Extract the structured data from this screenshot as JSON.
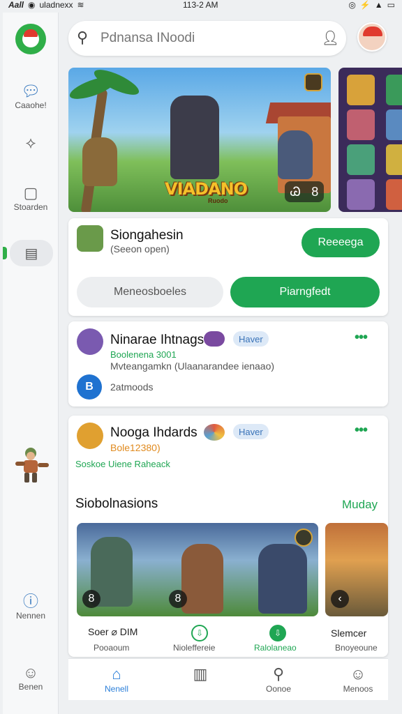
{
  "status_bar": {
    "carrier": "Aall",
    "network": "uladnexx",
    "time": "113-2 AM"
  },
  "rail": {
    "items": [
      {
        "label": "Caaohe!",
        "icon": "chat-bubble-icon"
      },
      {
        "label": "",
        "icon": "share-icon"
      },
      {
        "label": "Stoarden",
        "icon": "store-icon"
      },
      {
        "label": "",
        "icon": "calendar-icon"
      },
      {
        "label": "Nennen",
        "icon": "info-icon"
      },
      {
        "label": "Benen",
        "icon": "profile-icon"
      }
    ]
  },
  "search": {
    "placeholder": "Pdnansa INoodi"
  },
  "hero": {
    "title": "VIADANO",
    "subtitle": "Ruodo",
    "count_icon": "Ꮚ",
    "count": "8"
  },
  "featured": {
    "title": "Siongahesin",
    "subtitle": "(Seeon open)",
    "action_label": "Reeeega",
    "tab_left": "Meneosboeles",
    "tab_right": "Piarngfedt"
  },
  "post1": {
    "title": "Ninarae Ihtnags",
    "pill": "Haver",
    "green_line": "Boolenena 3001",
    "desc": "Mvteangamkn (Ulaanarandee ienaao)",
    "footer_text": "2atmoods",
    "footer_icon_letter": "B"
  },
  "post2": {
    "title": "Nooga Ihdards",
    "pill": "Haver",
    "orange_line": "Bole12380)",
    "green_line": "Soskoe Uiene  Raheack"
  },
  "section": {
    "title": "Siobolnasions",
    "action": "Muday"
  },
  "thumbs": [
    {
      "badge_left": "8",
      "badge_center": "8",
      "label": "Soer ⌀ DIM",
      "sub": "Pooaoum"
    },
    {
      "label": "",
      "sub": "Nioleffereie"
    },
    {
      "label": "",
      "sub": "Ralolaneao"
    },
    {
      "label": "Slemcer",
      "sub": "Bnoyeoune"
    }
  ],
  "bottom_nav": [
    {
      "label": "Nenell",
      "icon": "home-icon",
      "active": true
    },
    {
      "label": "",
      "icon": "book-icon",
      "active": false
    },
    {
      "label": "Oonoe",
      "icon": "search-person-icon",
      "active": false
    },
    {
      "label": "Menoos",
      "icon": "person-icon",
      "active": false
    }
  ],
  "colors": {
    "accent": "#1fa653",
    "link": "#2b7fd9",
    "pill_bg": "#dde9f7"
  }
}
